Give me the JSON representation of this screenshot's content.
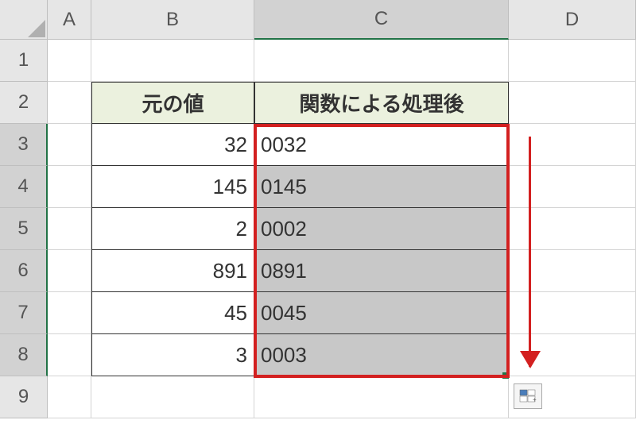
{
  "columns": [
    "A",
    "B",
    "C",
    "D"
  ],
  "rows": [
    "1",
    "2",
    "3",
    "4",
    "5",
    "6",
    "7",
    "8",
    "9"
  ],
  "headers": {
    "b": "元の値",
    "c": "関数による処理後"
  },
  "data": [
    {
      "b": "32",
      "c": "0032"
    },
    {
      "b": "145",
      "c": "0145"
    },
    {
      "b": "2",
      "c": "0002"
    },
    {
      "b": "891",
      "c": "0891"
    },
    {
      "b": "45",
      "c": "0045"
    },
    {
      "b": "3",
      "c": "0003"
    }
  ],
  "selected_column": "C",
  "selected_rows": [
    "3",
    "4",
    "5",
    "6",
    "7",
    "8"
  ]
}
